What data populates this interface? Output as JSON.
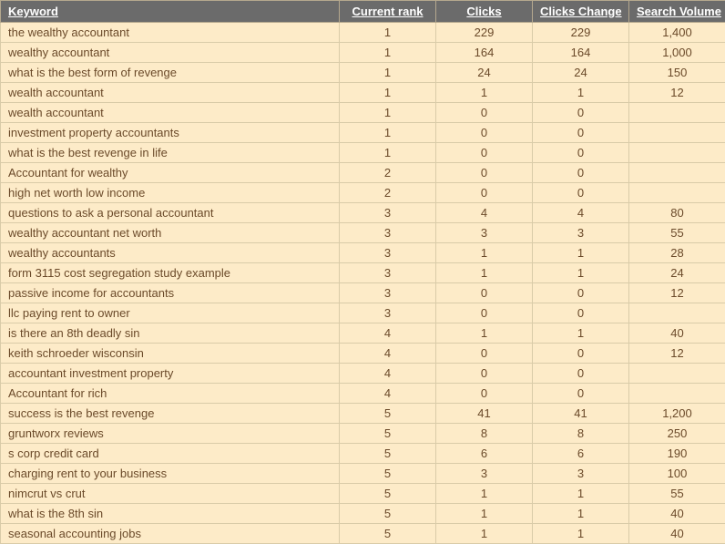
{
  "headers": {
    "keyword": "Keyword",
    "rank": "Current rank",
    "clicks": "Clicks",
    "change": "Clicks Change",
    "volume": "Search Volume"
  },
  "rows": [
    {
      "keyword": "the wealthy accountant",
      "rank": "1",
      "clicks": "229",
      "change": "229",
      "volume": "1,400"
    },
    {
      "keyword": "wealthy accountant",
      "rank": "1",
      "clicks": "164",
      "change": "164",
      "volume": "1,000"
    },
    {
      "keyword": "what is the best form of revenge",
      "rank": "1",
      "clicks": "24",
      "change": "24",
      "volume": "150"
    },
    {
      "keyword": "wealth accountant",
      "rank": "1",
      "clicks": "1",
      "change": "1",
      "volume": "12"
    },
    {
      "keyword": "wealth accountant",
      "rank": "1",
      "clicks": "0",
      "change": "0",
      "volume": ""
    },
    {
      "keyword": "investment property accountants",
      "rank": "1",
      "clicks": "0",
      "change": "0",
      "volume": ""
    },
    {
      "keyword": "what is the best revenge in life",
      "rank": "1",
      "clicks": "0",
      "change": "0",
      "volume": ""
    },
    {
      "keyword": "Accountant for wealthy",
      "rank": "2",
      "clicks": "0",
      "change": "0",
      "volume": ""
    },
    {
      "keyword": "high net worth low income",
      "rank": "2",
      "clicks": "0",
      "change": "0",
      "volume": ""
    },
    {
      "keyword": "questions to ask a personal accountant",
      "rank": "3",
      "clicks": "4",
      "change": "4",
      "volume": "80"
    },
    {
      "keyword": "wealthy accountant net worth",
      "rank": "3",
      "clicks": "3",
      "change": "3",
      "volume": "55"
    },
    {
      "keyword": "wealthy accountants",
      "rank": "3",
      "clicks": "1",
      "change": "1",
      "volume": "28"
    },
    {
      "keyword": "form 3115 cost segregation study example",
      "rank": "3",
      "clicks": "1",
      "change": "1",
      "volume": "24"
    },
    {
      "keyword": "passive income for accountants",
      "rank": "3",
      "clicks": "0",
      "change": "0",
      "volume": "12"
    },
    {
      "keyword": "llc paying rent to owner",
      "rank": "3",
      "clicks": "0",
      "change": "0",
      "volume": ""
    },
    {
      "keyword": "is there an 8th deadly sin",
      "rank": "4",
      "clicks": "1",
      "change": "1",
      "volume": "40"
    },
    {
      "keyword": "keith schroeder wisconsin",
      "rank": "4",
      "clicks": "0",
      "change": "0",
      "volume": "12"
    },
    {
      "keyword": "accountant investment property",
      "rank": "4",
      "clicks": "0",
      "change": "0",
      "volume": ""
    },
    {
      "keyword": "Accountant for rich",
      "rank": "4",
      "clicks": "0",
      "change": "0",
      "volume": ""
    },
    {
      "keyword": "success is the best revenge",
      "rank": "5",
      "clicks": "41",
      "change": "41",
      "volume": "1,200"
    },
    {
      "keyword": "gruntworx reviews",
      "rank": "5",
      "clicks": "8",
      "change": "8",
      "volume": "250"
    },
    {
      "keyword": "s corp credit card",
      "rank": "5",
      "clicks": "6",
      "change": "6",
      "volume": "190"
    },
    {
      "keyword": "charging rent to your business",
      "rank": "5",
      "clicks": "3",
      "change": "3",
      "volume": "100"
    },
    {
      "keyword": "nimcrut vs crut",
      "rank": "5",
      "clicks": "1",
      "change": "1",
      "volume": "55"
    },
    {
      "keyword": "what is the 8th sin",
      "rank": "5",
      "clicks": "1",
      "change": "1",
      "volume": "40"
    },
    {
      "keyword": "seasonal accounting jobs",
      "rank": "5",
      "clicks": "1",
      "change": "1",
      "volume": "40"
    }
  ]
}
